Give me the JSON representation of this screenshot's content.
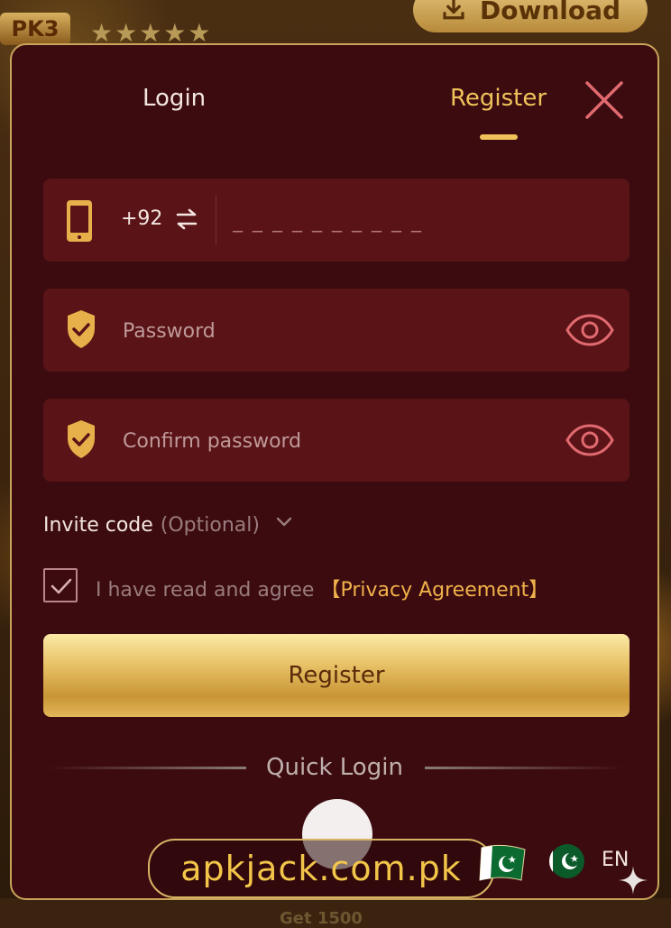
{
  "background": {
    "app_badge": "PK3",
    "rating_stars": "★★★★★",
    "download_label": "Download",
    "bottom_text": "Get 1500"
  },
  "tabs": {
    "login": "Login",
    "register": "Register",
    "active": "register"
  },
  "phone": {
    "country_code": "+92",
    "placeholder": "_ _ _ _ _ _ _ _ _ _",
    "value": ""
  },
  "password": {
    "placeholder": "Password",
    "value": ""
  },
  "confirm_password": {
    "placeholder": "Confirm password",
    "value": ""
  },
  "invite": {
    "label": "Invite code",
    "optional": "(Optional)"
  },
  "agreement": {
    "checked": true,
    "text": "I have read and agree",
    "link": "【Privacy Agreement】"
  },
  "register_button": "Register",
  "quick_login": {
    "label": "Quick Login"
  },
  "language": {
    "code": "EN"
  },
  "watermark": {
    "text": "apkjack.com.pk"
  },
  "colors": {
    "modal_bg": "#3c0b10",
    "field_bg": "#5a1316",
    "accent_gold": "#f0c35a",
    "close_pink": "#e06a70",
    "link_orange": "#f0b24a"
  }
}
